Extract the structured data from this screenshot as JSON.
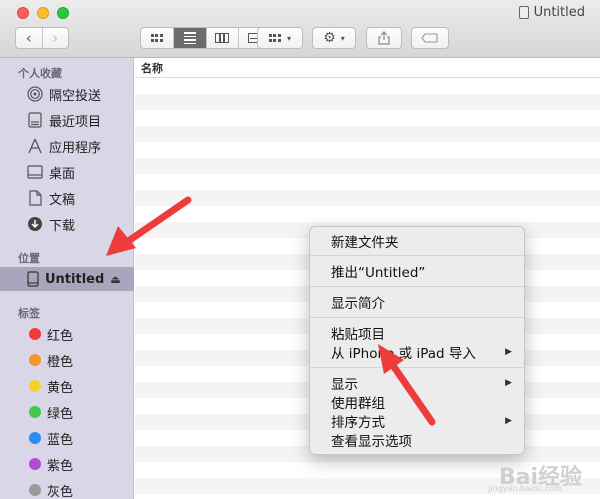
{
  "window": {
    "title": "Untitled"
  },
  "toolbar": {
    "back_icon": "chevron-left-icon",
    "forward_icon": "chevron-right-icon",
    "view_modes": [
      "icon-view",
      "list-view",
      "column-view",
      "gallery-view"
    ],
    "active_view": "list-view"
  },
  "sidebar": {
    "favorites_header": "个人收藏",
    "favorites": [
      {
        "label": "隔空投送",
        "icon": "airdrop-icon"
      },
      {
        "label": "最近项目",
        "icon": "recents-icon"
      },
      {
        "label": "应用程序",
        "icon": "applications-icon"
      },
      {
        "label": "桌面",
        "icon": "desktop-icon"
      },
      {
        "label": "文稿",
        "icon": "documents-icon"
      },
      {
        "label": "下载",
        "icon": "downloads-icon"
      }
    ],
    "locations_header": "位置",
    "locations": [
      {
        "label": "Untitled",
        "icon": "drive-icon",
        "selected": true
      }
    ],
    "tags_header": "标签",
    "tags": [
      {
        "label": "红色",
        "color": "#f23a3a"
      },
      {
        "label": "橙色",
        "color": "#f7952a"
      },
      {
        "label": "黄色",
        "color": "#f6d02b"
      },
      {
        "label": "绿色",
        "color": "#3ccb4a"
      },
      {
        "label": "蓝色",
        "color": "#2a8bf2"
      },
      {
        "label": "紫色",
        "color": "#b44ad3"
      },
      {
        "label": "灰色",
        "color": "#9a9a9a"
      }
    ]
  },
  "main": {
    "column_header": "名称"
  },
  "context_menu": {
    "items": [
      "新建文件夹",
      "推出“Untitled”",
      "显示简介",
      "粘贴项目",
      "从 iPhone 或 iPad 导入",
      "显示",
      "使用群组",
      "排序方式",
      "查看显示选项"
    ]
  },
  "annotation": {
    "arrow_color": "#ee3b3b"
  },
  "watermark": {
    "text": "Bai经验",
    "sub": "jingyan.baidu.com"
  }
}
